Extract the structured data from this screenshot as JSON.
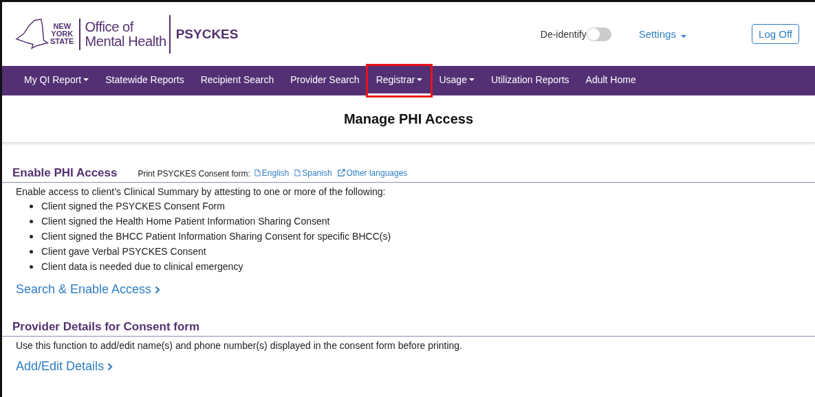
{
  "header": {
    "logo": {
      "state_lines": [
        "NEW",
        "YORK",
        "STATE"
      ],
      "office": [
        "Office of",
        "Mental Health"
      ],
      "app": "PSYCKES"
    },
    "deidentify": {
      "label": "De-identify",
      "on": false
    },
    "settings": "Settings",
    "logoff": "Log Off"
  },
  "nav": [
    {
      "label": "My QI Report",
      "kind": "menu",
      "selected": false,
      "highlighted": false
    },
    {
      "label": "Statewide Reports",
      "kind": "link",
      "selected": false,
      "highlighted": false
    },
    {
      "label": "Recipient Search",
      "kind": "link",
      "selected": false,
      "highlighted": false
    },
    {
      "label": "Provider Search",
      "kind": "link",
      "selected": false,
      "highlighted": false
    },
    {
      "label": "Registrar",
      "kind": "menu",
      "selected": true,
      "highlighted": true
    },
    {
      "label": "Usage",
      "kind": "menu",
      "selected": false,
      "highlighted": false
    },
    {
      "label": "Utilization Reports",
      "kind": "link",
      "selected": false,
      "highlighted": false
    },
    {
      "label": "Adult Home",
      "kind": "link",
      "selected": false,
      "highlighted": false
    }
  ],
  "page_title": "Manage PHI Access",
  "sections": [
    {
      "title": "Enable PHI Access",
      "print_label": "Print PSYCKES Consent form:",
      "print_links": [
        {
          "label": "English",
          "kind": "pdf"
        },
        {
          "label": "Spanish",
          "kind": "pdf"
        },
        {
          "label": "Other languages",
          "kind": "external"
        }
      ],
      "intro": "Enable access to client’s Clinical Summary by attesting to one or more of the following:",
      "bullets": [
        "Client signed the PSYCKES Consent Form",
        "Client signed the Health Home Patient Information Sharing Consent",
        "Client signed the BHCC Patient Information Sharing Consent for specific BHCC(s)",
        "Client gave Verbal PSYCKES Consent",
        "Client data is needed due to clinical emergency"
      ],
      "action": "Search & Enable Access"
    },
    {
      "title": "Provider Details for Consent form",
      "intro": "Use this function to add/edit name(s) and phone number(s) displayed in the consent form before printing.",
      "action": "Add/Edit Details"
    }
  ]
}
